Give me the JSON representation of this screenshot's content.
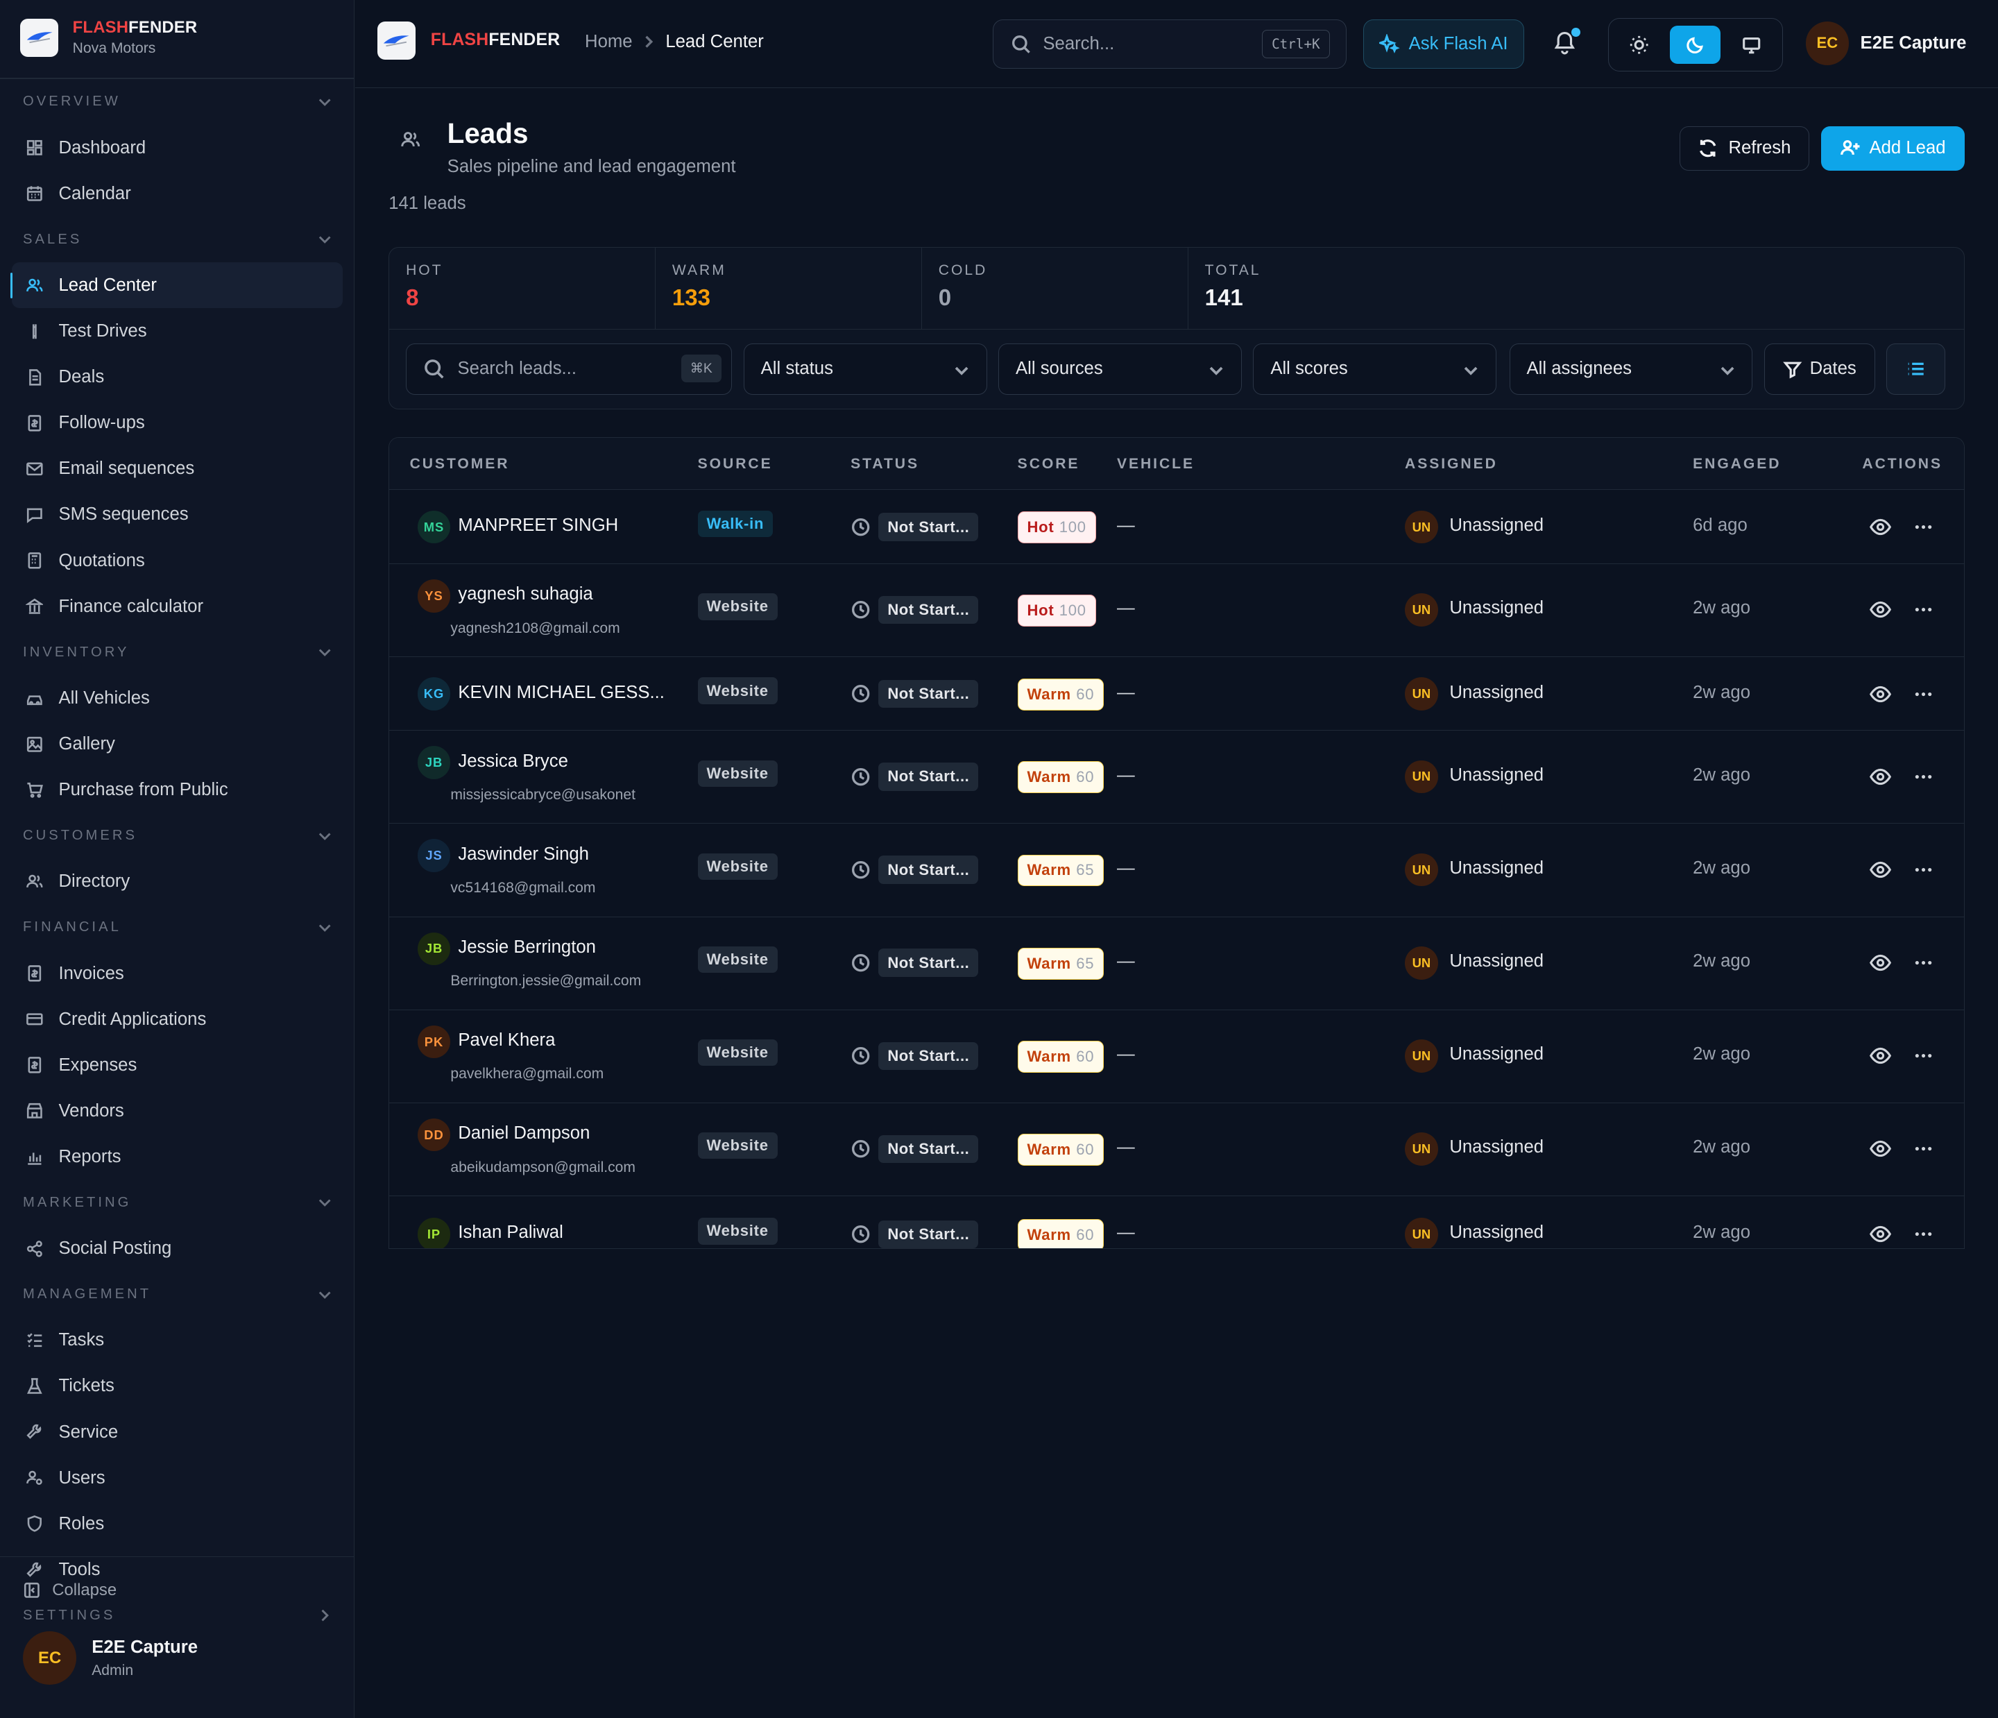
{
  "brand": {
    "part1": "FLASH",
    "part2": "FENDER",
    "org": "Nova Motors"
  },
  "sidebar": {
    "sections": [
      {
        "title": "OVERVIEW",
        "items": [
          "Dashboard",
          "Calendar"
        ]
      },
      {
        "title": "SALES",
        "items": [
          "Lead Center",
          "Test Drives",
          "Deals",
          "Follow-ups",
          "Email sequences",
          "SMS sequences",
          "Quotations",
          "Finance calculator"
        ]
      },
      {
        "title": "INVENTORY",
        "items": [
          "All Vehicles",
          "Gallery",
          "Purchase from Public"
        ]
      },
      {
        "title": "CUSTOMERS",
        "items": [
          "Directory"
        ]
      },
      {
        "title": "FINANCIAL",
        "items": [
          "Invoices",
          "Credit Applications",
          "Expenses",
          "Vendors",
          "Reports"
        ]
      },
      {
        "title": "MARKETING",
        "items": [
          "Social Posting"
        ]
      },
      {
        "title": "MANAGEMENT",
        "items": [
          "Tasks",
          "Tickets",
          "Service",
          "Users",
          "Roles",
          "Tools"
        ]
      },
      {
        "title": "SETTINGS",
        "items": []
      }
    ],
    "active": "Lead Center",
    "collapse_label": "Collapse",
    "user": {
      "initials": "EC",
      "name": "E2E Capture",
      "role": "Admin"
    }
  },
  "topbar": {
    "breadcrumb": [
      "Home",
      "Lead Center"
    ],
    "search_placeholder": "Search...",
    "search_kbd": "Ctrl+K",
    "ask_ai": "Ask Flash AI",
    "user": {
      "initials": "EC",
      "name": "E2E Capture"
    }
  },
  "page": {
    "title": "Leads",
    "subtitle": "Sales pipeline and lead engagement",
    "count": "141 leads",
    "refresh": "Refresh",
    "add": "Add Lead"
  },
  "stats": [
    {
      "label": "HOT",
      "value": "8",
      "color": "#ef4444"
    },
    {
      "label": "WARM",
      "value": "133",
      "color": "#f59e0b"
    },
    {
      "label": "COLD",
      "value": "0",
      "color": "#9ca3af"
    },
    {
      "label": "TOTAL",
      "value": "141",
      "color": "#f3f4f6"
    }
  ],
  "filters": {
    "search_placeholder": "Search leads...",
    "search_kbd": "⌘K",
    "status": "All status",
    "sources": "All sources",
    "scores": "All scores",
    "assignees": "All assignees",
    "dates": "Dates"
  },
  "columns": [
    "CUSTOMER",
    "SOURCE",
    "STATUS",
    "SCORE",
    "VEHICLE",
    "ASSIGNED",
    "ENGAGED",
    "ACTIONS"
  ],
  "leads": [
    {
      "initials": "MS",
      "name": "MANPREET SINGH",
      "email": "",
      "source": "Walk-in",
      "status": "Not Start...",
      "score_label": "Hot",
      "score": "100",
      "vehicle": "—",
      "assigned_initials": "UN",
      "assigned": "Unassigned",
      "engaged": "6d ago"
    },
    {
      "initials": "YS",
      "name": "yagnesh suhagia",
      "email": "yagnesh2108@gmail.com",
      "source": "Website",
      "status": "Not Start...",
      "score_label": "Hot",
      "score": "100",
      "vehicle": "—",
      "assigned_initials": "UN",
      "assigned": "Unassigned",
      "engaged": "2w ago"
    },
    {
      "initials": "KG",
      "name": "KEVIN MICHAEL GESS...",
      "email": "",
      "source": "Website",
      "status": "Not Start...",
      "score_label": "Warm",
      "score": "60",
      "vehicle": "—",
      "assigned_initials": "UN",
      "assigned": "Unassigned",
      "engaged": "2w ago"
    },
    {
      "initials": "JB",
      "name": "Jessica Bryce",
      "email": "missjessicabryce@usakonet",
      "source": "Website",
      "status": "Not Start...",
      "score_label": "Warm",
      "score": "60",
      "vehicle": "—",
      "assigned_initials": "UN",
      "assigned": "Unassigned",
      "engaged": "2w ago"
    },
    {
      "initials": "JS",
      "name": "Jaswinder Singh",
      "email": "vc514168@gmail.com",
      "source": "Website",
      "status": "Not Start...",
      "score_label": "Warm",
      "score": "65",
      "vehicle": "—",
      "assigned_initials": "UN",
      "assigned": "Unassigned",
      "engaged": "2w ago"
    },
    {
      "initials": "JB",
      "name": "Jessie Berrington",
      "email": "Berrington.jessie@gmail.com",
      "source": "Website",
      "status": "Not Start...",
      "score_label": "Warm",
      "score": "65",
      "vehicle": "—",
      "assigned_initials": "UN",
      "assigned": "Unassigned",
      "engaged": "2w ago"
    },
    {
      "initials": "PK",
      "name": "Pavel Khera",
      "email": "pavelkhera@gmail.com",
      "source": "Website",
      "status": "Not Start...",
      "score_label": "Warm",
      "score": "60",
      "vehicle": "—",
      "assigned_initials": "UN",
      "assigned": "Unassigned",
      "engaged": "2w ago"
    },
    {
      "initials": "DD",
      "name": "Daniel Dampson",
      "email": "abeikudampson@gmail.com",
      "source": "Website",
      "status": "Not Start...",
      "score_label": "Warm",
      "score": "60",
      "vehicle": "—",
      "assigned_initials": "UN",
      "assigned": "Unassigned",
      "engaged": "2w ago"
    },
    {
      "initials": "IP",
      "name": "Ishan Paliwal",
      "email": "",
      "source": "Website",
      "status": "Not Start...",
      "score_label": "Warm",
      "score": "60",
      "vehicle": "—",
      "assigned_initials": "UN",
      "assigned": "Unassigned",
      "engaged": "2w ago"
    }
  ]
}
